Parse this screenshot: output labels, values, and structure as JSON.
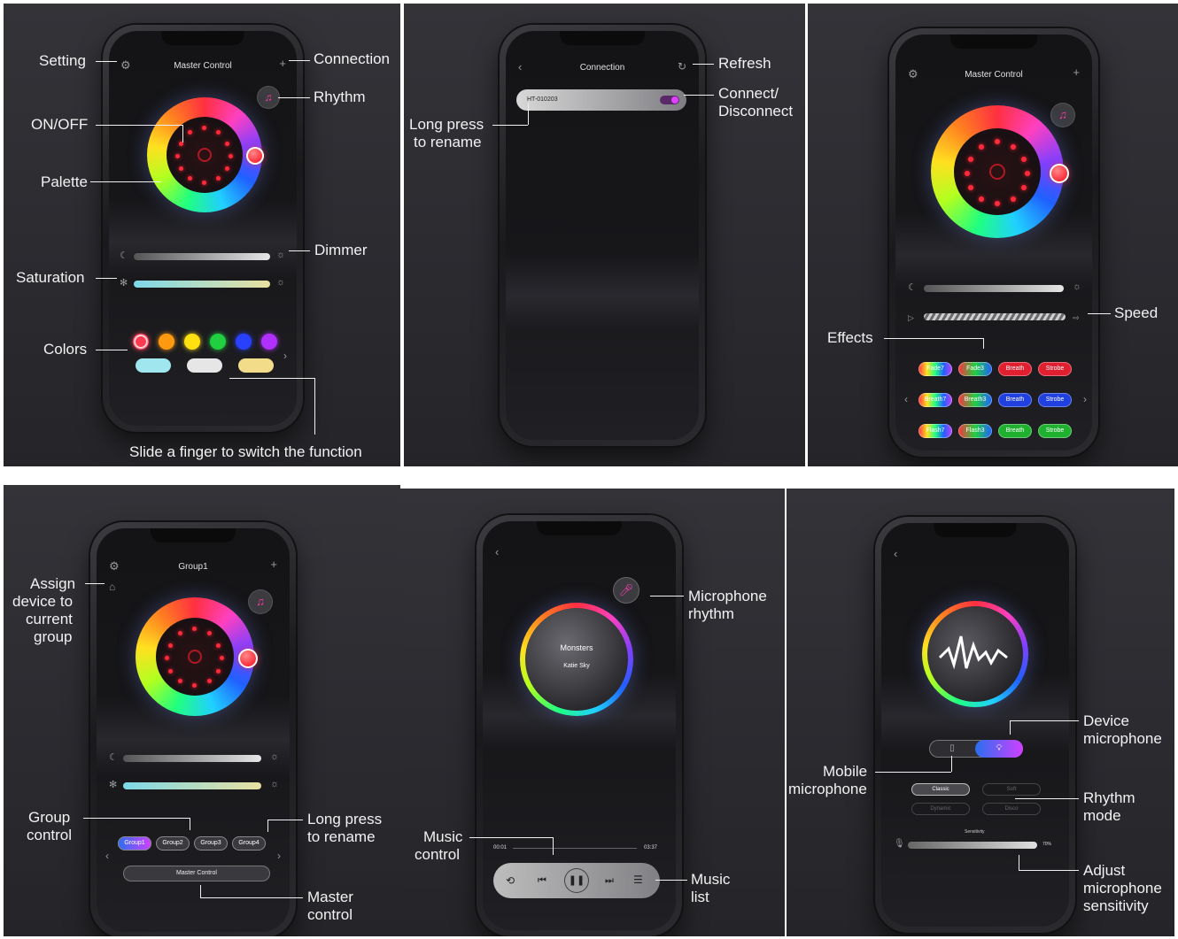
{
  "panels": {
    "p1": {
      "title": "Master Control",
      "callouts": {
        "setting": "Setting",
        "connection": "Connection",
        "rhythm": "Rhythm",
        "onoff": "ON/OFF",
        "palette": "Palette",
        "dimmer": "Dimmer",
        "saturation": "Saturation",
        "colors": "Colors",
        "slide": "Slide a finger to  switch the  function"
      },
      "colors": [
        "#ff3a50",
        "#ff9a10",
        "#ffe010",
        "#20d040",
        "#2a40ff",
        "#b030ff"
      ],
      "presets": [
        "#9fe6ee",
        "#e6e6e6",
        "#f2dc8a"
      ]
    },
    "p2": {
      "title": "Connection",
      "device": "HT-010203",
      "callouts": {
        "refresh": "Refresh",
        "connect1": "Connect/",
        "connect2": "Disconnect",
        "long1": "Long press",
        "long2": "to rename"
      }
    },
    "p3": {
      "title": "Master Control",
      "callouts": {
        "speed": "Speed",
        "effects": "Effects"
      },
      "effects": [
        {
          "label": "Fade7",
          "color": "rainbow"
        },
        {
          "label": "Fade3",
          "color": "rgb"
        },
        {
          "label": "Breath",
          "color": "#e02030"
        },
        {
          "label": "Strobe",
          "color": "#e02030"
        },
        {
          "label": "Breath7",
          "color": "rainbow"
        },
        {
          "label": "Breath3",
          "color": "rgb"
        },
        {
          "label": "Breath",
          "color": "#2040e0"
        },
        {
          "label": "Strobe",
          "color": "#2040e0"
        },
        {
          "label": "Flash7",
          "color": "rainbow"
        },
        {
          "label": "Flash3",
          "color": "rgb"
        },
        {
          "label": "Breath",
          "color": "#20b030"
        },
        {
          "label": "Strobe",
          "color": "#20b030"
        }
      ]
    },
    "p4": {
      "title": "Group1",
      "callouts": {
        "assign1": "Assign",
        "assign2": "device to",
        "assign3": "current",
        "assign4": "group",
        "group1": "Group",
        "group2": "control",
        "long1": "Long press",
        "long2": "to rename",
        "master1": "Master",
        "master2": "control"
      },
      "groups": [
        "Group1",
        "Group2",
        "Group3",
        "Group4"
      ],
      "master_button": "Master Control"
    },
    "p5": {
      "song": "Monsters",
      "artist": "Katie Sky",
      "time_start": "00:01",
      "time_end": "03:37",
      "callouts": {
        "mic1": "Microphone",
        "mic2": "rhythm",
        "music1": "Music",
        "music2": "control",
        "list1": "Music",
        "list2": "list"
      }
    },
    "p6": {
      "modes": [
        "Classic",
        "Soft",
        "Dynamic",
        "Disco"
      ],
      "sensitivity_label": "Sensitivity",
      "sensitivity_value": "70%",
      "callouts": {
        "device1": "Device",
        "device2": "microphone",
        "mobile1": "Mobile",
        "mobile2": "microphone",
        "rhythm1": "Rhythm",
        "rhythm2": "mode",
        "adjust1": "Adjust",
        "adjust2": "microphone",
        "adjust3": "sensitivity"
      }
    }
  }
}
